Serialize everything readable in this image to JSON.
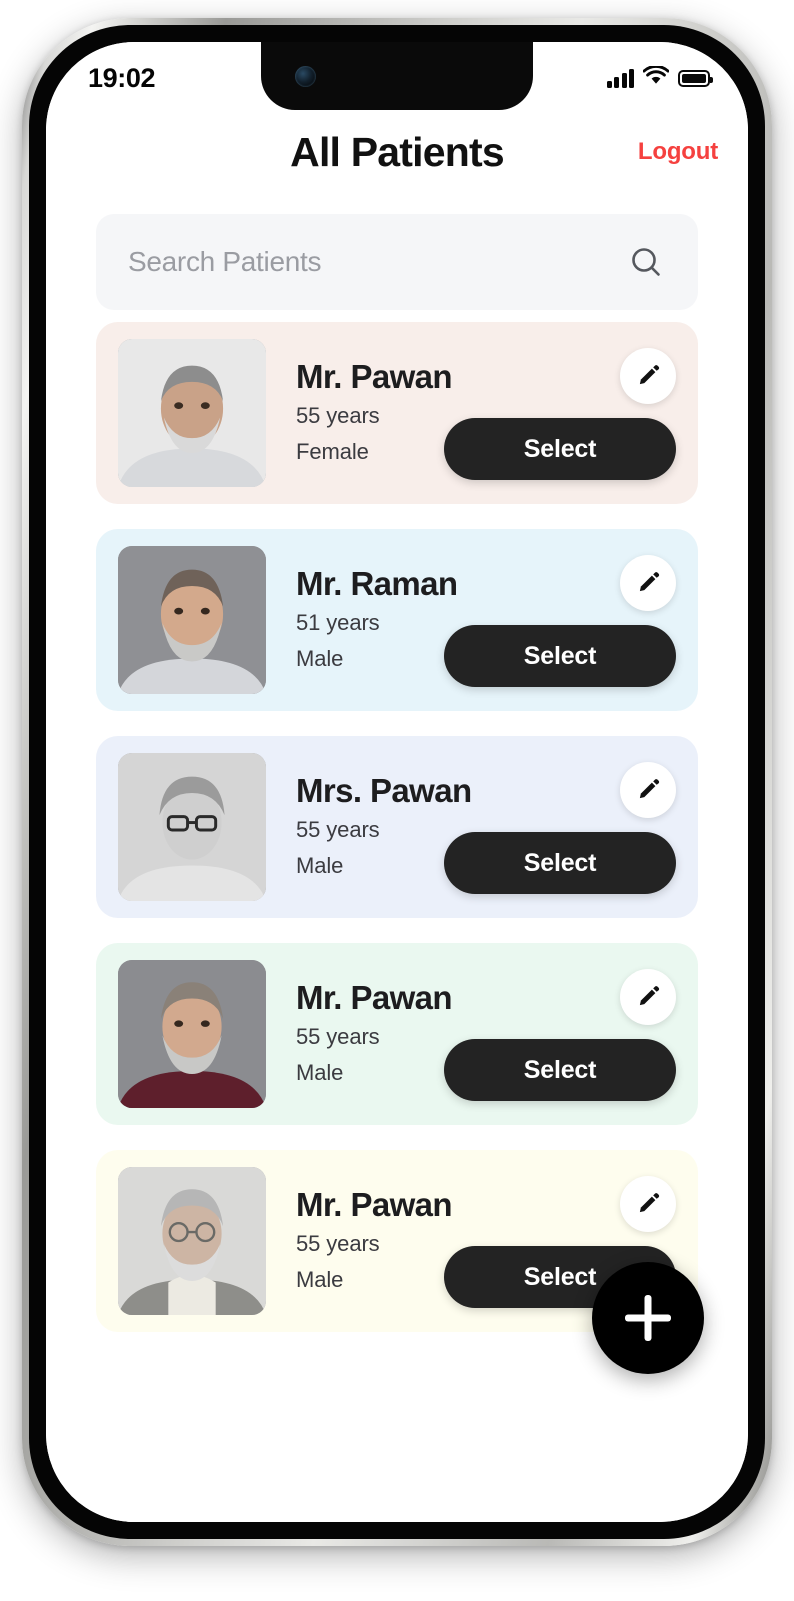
{
  "status_bar": {
    "time": "19:02",
    "signal_icon": "cellular-signal-icon",
    "wifi_icon": "wifi-icon",
    "battery_icon": "battery-full-icon"
  },
  "header": {
    "title": "All Patients",
    "logout_label": "Logout",
    "logout_color": "#f5413f"
  },
  "search": {
    "placeholder": "Search Patients",
    "value": "",
    "icon": "search-icon"
  },
  "list": {
    "edit_icon": "pencil-edit-icon",
    "select_label": "Select",
    "patients": [
      {
        "name": "Mr. Pawan",
        "age": "55 years",
        "gender": "Female",
        "card_color": "#f8eeea",
        "avatar_skin": "#c9a288",
        "avatar_hair": "#8d8d8d",
        "avatar_shirt": "#d7d9dc",
        "avatar_bg": "#e8e8e8",
        "avatar_beard": "#d9d9d9"
      },
      {
        "name": "Mr. Raman",
        "age": "51 years",
        "gender": "Male",
        "card_color": "#e6f4fa",
        "avatar_skin": "#d3a98c",
        "avatar_hair": "#6f6259",
        "avatar_shirt": "#d4d6da",
        "avatar_bg": "#8f9094",
        "avatar_beard": "#c9c9c7"
      },
      {
        "name": "Mrs. Pawan",
        "age": "55 years",
        "gender": "Male",
        "card_color": "#ebf0fa",
        "avatar_skin": "#cfcfcf",
        "avatar_hair": "#9b9b9b",
        "avatar_shirt": "#e4e4e4",
        "avatar_bg": "#d5d5d5",
        "avatar_beard": "#cfcfcf"
      },
      {
        "name": "Mr. Pawan",
        "age": "55 years",
        "gender": "Male",
        "card_color": "#eaf8f0",
        "avatar_skin": "#d2a98e",
        "avatar_hair": "#8a8178",
        "avatar_shirt": "#5e1f2c",
        "avatar_bg": "#8b8c90",
        "avatar_beard": "#c8c8c6"
      },
      {
        "name": "Mr. Pawan",
        "age": "55 years",
        "gender": "Male",
        "card_color": "#fefdee",
        "avatar_skin": "#cdb5a4",
        "avatar_hair": "#b6b6b6",
        "avatar_shirt": "#8e8e8a",
        "avatar_bg": "#d9d9d7",
        "avatar_beard": "#dcdcdc"
      }
    ]
  },
  "fab": {
    "icon": "plus-icon",
    "label": "Add patient"
  }
}
